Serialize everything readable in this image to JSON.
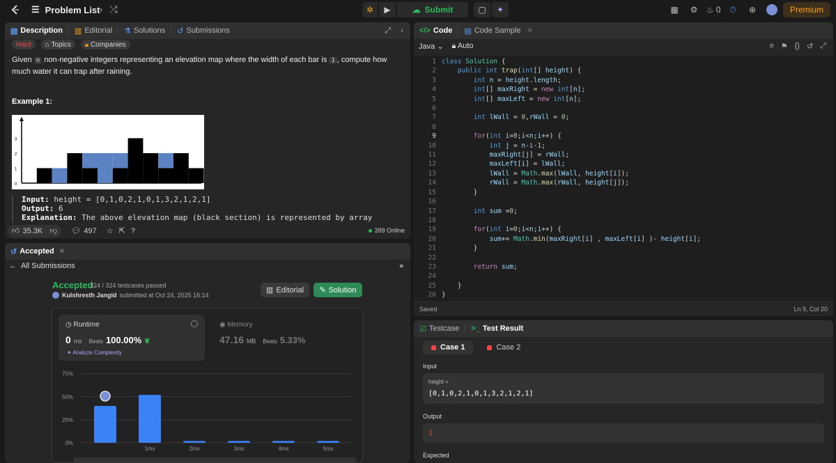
{
  "nav": {
    "problem_list": "Problem List",
    "submit_label": "Submit",
    "streak_count": "0",
    "premium": "Premium"
  },
  "description": {
    "tabs": [
      "Description",
      "Editorial",
      "Solutions",
      "Submissions"
    ],
    "difficulty": "Hard",
    "topics": "Topics",
    "companies": "Companies",
    "text_1": "Given",
    "code_n": "n",
    "text_2": "non-negative integers representing an elevation map where the width of each bar is",
    "code_1": "1",
    "text_3": ", compute how much water it can trap after raining.",
    "example_title": "Example 1:",
    "diagram": {
      "y_ticks": [
        "0",
        "1",
        "2",
        "3"
      ],
      "bars": [
        0,
        1,
        0,
        2,
        1,
        0,
        1,
        3,
        2,
        1,
        2,
        1
      ],
      "water": [
        0,
        0,
        1,
        0,
        1,
        2,
        1,
        0,
        0,
        1,
        0,
        0
      ]
    },
    "input_label": "Input:",
    "input_value": "height = [0,1,0,2,1,0,1,3,2,1,2,1]",
    "output_label": "Output:",
    "output_value": "6",
    "explanation_label": "Explanation:",
    "explanation_value": "The above elevation map (black section) is represented by array",
    "likes": "35.3K",
    "comments": "497",
    "online": "399 Online"
  },
  "accepted": {
    "tab_label": "Accepted",
    "all_submissions": "All Submissions",
    "status": "Accepted",
    "testcases": "324 / 324 testcases passed",
    "user": "Kulshresth Jangid",
    "submitted": "submitted at Oct 24, 2025 16:14",
    "editorial_btn": "Editorial",
    "solution_btn": "Solution",
    "runtime_label": "Runtime",
    "runtime_value": "0",
    "runtime_unit": "ms",
    "beats_label": "Beats",
    "runtime_beats": "100.00%",
    "analyze": "Analyze Complexity",
    "memory_label": "Memory",
    "memory_value": "47.16",
    "memory_unit": "MB",
    "memory_beats": "5.33%"
  },
  "chart_data": {
    "type": "bar",
    "categories": [
      "0ms",
      "1ms",
      "2ms",
      "3ms",
      "4ms",
      "5ms"
    ],
    "values": [
      40,
      52,
      2,
      2,
      2,
      2
    ],
    "y_ticks": [
      "75%",
      "50%",
      "25%",
      "0%"
    ],
    "x_tick_labels": [
      "1ms",
      "2ms",
      "3ms",
      "4ms",
      "5ms"
    ],
    "ylim": [
      0,
      80
    ],
    "highlight_index": 0,
    "bar_color": "#3b82f6"
  },
  "editor": {
    "tab_code": "Code",
    "tab_sample": "Code Sample",
    "language": "Java",
    "mode": "Auto",
    "saved": "Saved",
    "cursor": "Ln 9, Col 20",
    "current_line": 9
  },
  "testcase": {
    "tab_testcase": "Testcase",
    "tab_result": "Test Result",
    "case1": "Case 1",
    "case2": "Case 2",
    "input_label": "Input",
    "var_name": "height =",
    "var_value": "[0,1,0,2,1,0,1,3,2,1,2,1]",
    "output_label": "Output",
    "output_value": "1",
    "expected_label": "Expected"
  }
}
